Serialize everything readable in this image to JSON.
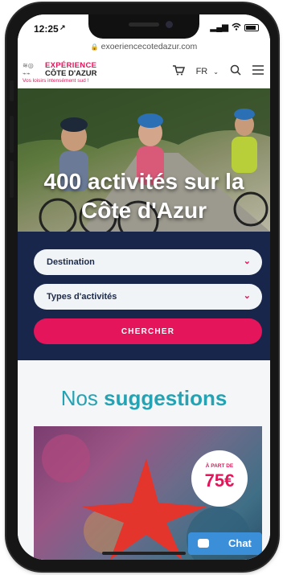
{
  "status_bar": {
    "time": "12:25",
    "location_arrow": "↗"
  },
  "browser": {
    "url": "exoerienceсotedazur.com",
    "lock_icon": "lock-icon"
  },
  "header": {
    "logo_line1": "EXPÉRIENCE",
    "logo_line2": "CÔTE D'AZUR",
    "logo_tagline": "Vos loisirs intensément sud !",
    "language": "FR"
  },
  "hero": {
    "title": "400 activités sur la Côte d'Azur"
  },
  "search": {
    "destination_label": "Destination",
    "activity_types_label": "Types d'activités",
    "search_button": "CHERCHER"
  },
  "suggestions": {
    "title_light": "Nos",
    "title_bold": "suggestions",
    "card": {
      "price_prefix": "À PART DE",
      "price": "75€"
    }
  },
  "chat": {
    "label": "Chat"
  },
  "colors": {
    "accent": "#e4155b",
    "navy": "#17264a",
    "teal": "#23a3b3",
    "chat_blue": "#3b8fd9"
  }
}
